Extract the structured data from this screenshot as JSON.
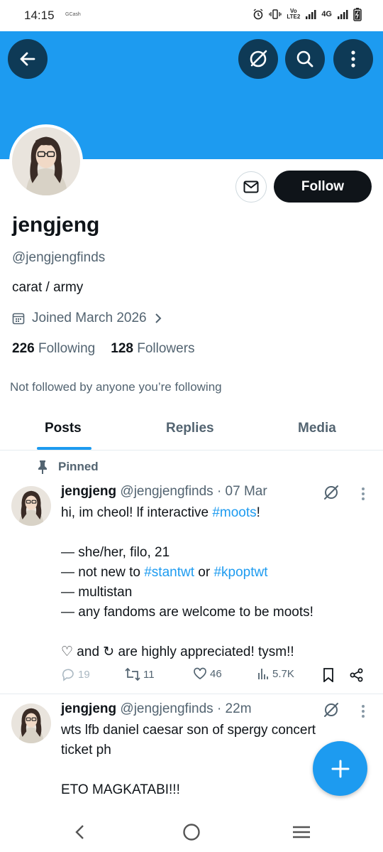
{
  "status_bar": {
    "time": "14:15",
    "app_label": "GCash",
    "volte": "VoB\nLTE2",
    "network": "4G"
  },
  "profile": {
    "display_name": "jengjeng",
    "handle": "@jengjengfinds",
    "bio": "carat / army",
    "joined": "Joined March 2026",
    "following_count": "226",
    "following_label": "Following",
    "followers_count": "128",
    "followers_label": "Followers",
    "not_followed": "Not followed by anyone you’re following",
    "follow_label": "Follow"
  },
  "tabs": [
    {
      "label": "Posts"
    },
    {
      "label": "Replies"
    },
    {
      "label": "Media"
    }
  ],
  "pinned_label": "Pinned",
  "posts": [
    {
      "name": "jengjeng",
      "handle": "@jengjengfinds",
      "time": "· 07 Mar",
      "line1a": "hi, im cheol! lf interactive ",
      "line1_tag": "#moots",
      "line1b": "!",
      "line2": "— she/her, filo, 21",
      "line3a": "— not new to ",
      "line3_tag1": "#stantwt",
      "line3_mid": " or ",
      "line3_tag2": "#kpoptwt",
      "line4": "— multistan",
      "line5": "— any fandoms are welcome to be moots!",
      "line6": "♡ and ↻ are highly appreciated! tysm!!",
      "replies": "19",
      "reposts": "11",
      "likes": "46",
      "views": "5.7K"
    },
    {
      "name": "jengjeng",
      "handle": "@jengjengfinds",
      "time": "· 22m",
      "text_line1": "wts lfb daniel caesar son of spergy concert",
      "text_line2": "ticket ph",
      "text_line3": "ETO MAGKATABI!!!"
    }
  ],
  "colors": {
    "accent": "#1d9bf0",
    "dark": "#0f1419",
    "muted": "#536471",
    "banner": "#1d9bf0"
  }
}
